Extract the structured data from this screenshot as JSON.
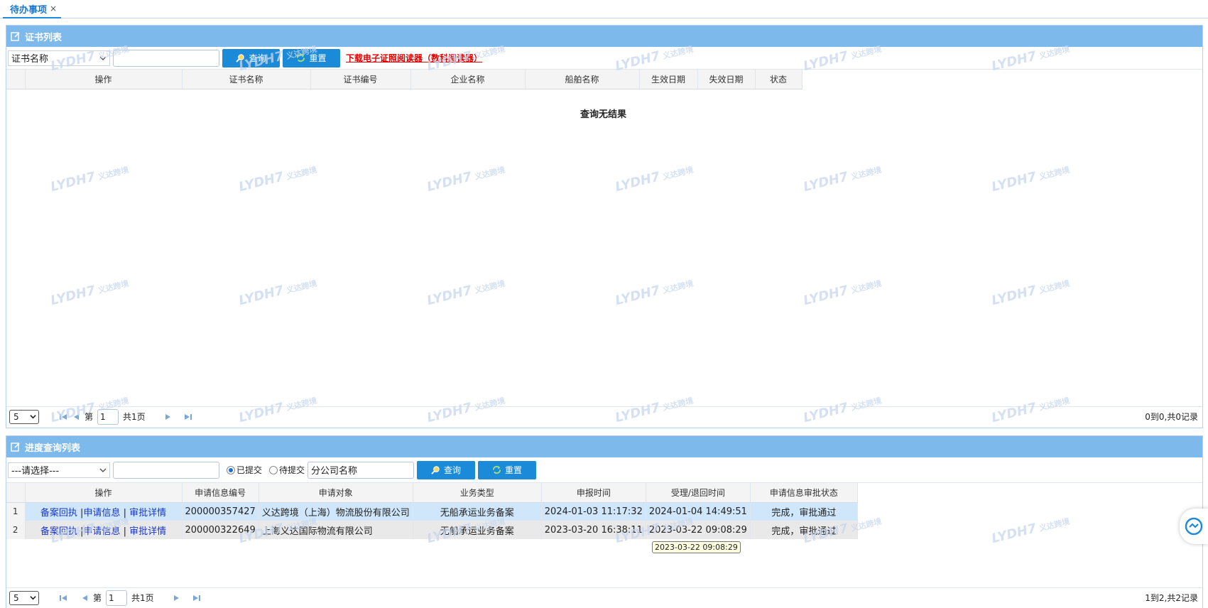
{
  "tabs": [
    {
      "label": "待办事项",
      "close": "×"
    }
  ],
  "colors": {
    "accent": "#1b8ad8",
    "panel_header": "#7eb9ec",
    "link_red": "#e00000",
    "link_blue": "#1a37c8",
    "row_selected": "#cfe6fb"
  },
  "cert_panel": {
    "title": "证书列表",
    "filter_select": "证书名称",
    "search_value": "",
    "query_label": "查询",
    "reset_label": "重置",
    "download_link": "下载电子证照阅读器（数科阅读器）",
    "columns": [
      "操作",
      "证书名称",
      "证书编号",
      "企业名称",
      "船舶名称",
      "生效日期",
      "失效日期",
      "状态"
    ],
    "empty_message": "查询无结果",
    "pager": {
      "page_size": "5",
      "page_prefix": "第",
      "page": "1",
      "page_total": "共1页",
      "info": "0到0,共0记录"
    }
  },
  "progress_panel": {
    "title": "进度查询列表",
    "filter_select": "---请选择---",
    "search_value": "",
    "radio_submitted": "已提交",
    "radio_pending": "待提交",
    "company_placeholder": "分公司名称",
    "query_label": "查询",
    "reset_label": "重置",
    "columns": [
      "操作",
      "申请信息编号",
      "申请对象",
      "业务类型",
      "申报时间",
      "受理/退回时间",
      "申请信息审批状态"
    ],
    "rows": [
      {
        "index": "1",
        "action_1": "备案回执",
        "action_2": "申请信息",
        "action_3": "审批详情",
        "app_no": "200000357427",
        "target": "义达跨境（上海）物流股份有限公司",
        "biz_type": "无船承运业务备案",
        "submit_time": "2024-01-03 11:17:32",
        "accept_time": "2024-01-04 14:49:51",
        "status": "完成，审批通过"
      },
      {
        "index": "2",
        "action_1": "备案回执",
        "action_2": "申请信息",
        "action_3": "审批详情",
        "app_no": "200000322649",
        "target": "上海义达国际物流有限公司",
        "biz_type": "无船承运业务备案",
        "submit_time": "2023-03-20 16:38:11",
        "accept_time": "2023-03-22 09:08:29",
        "status": "完成，审批通过"
      }
    ],
    "tooltip": "2023-03-22 09:08:29",
    "pager": {
      "page_size": "5",
      "page_prefix": "第",
      "page": "1",
      "page_total": "共1页",
      "info": "1到2,共2记录"
    }
  },
  "watermark": {
    "brand": "LYDH7",
    "text": "义达跨境"
  }
}
